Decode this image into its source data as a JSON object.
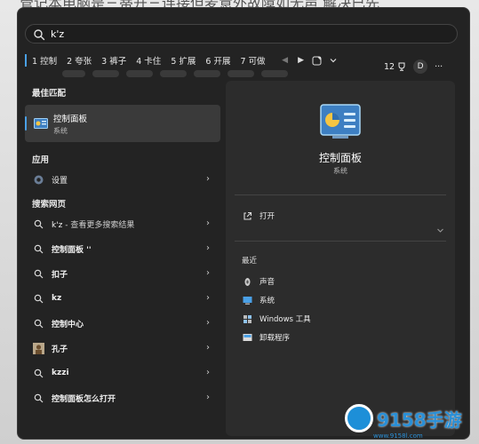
{
  "background": {
    "article_text": "管记本电脑是三蒂开三连接但麦意外故障如无声 解决已先"
  },
  "search": {
    "value": "k'z"
  },
  "ime": {
    "candidates": [
      "1 控制",
      "2 夸张",
      "3 裤子",
      "4 卡住",
      "5 扩展",
      "6 开展",
      "7 可做"
    ]
  },
  "header": {
    "points": "12",
    "avatar_letter": "D",
    "more": "···"
  },
  "left": {
    "best_match_title": "最佳匹配",
    "best_match": {
      "name": "控制面板",
      "type": "系统"
    },
    "apps_title": "应用",
    "apps": [
      {
        "label": "设置",
        "icon": "gear-icon"
      }
    ],
    "web_title": "搜索网页",
    "web": [
      {
        "label": "k'z",
        "sub": " - 查看更多搜索结果",
        "icon": "search-icon"
      },
      {
        "label": "控制面板 ''",
        "sub": "",
        "icon": "search-icon"
      },
      {
        "label": "扣子",
        "sub": "",
        "icon": "search-icon"
      },
      {
        "label": "kz",
        "sub": "",
        "icon": "search-icon"
      },
      {
        "label": "控制中心",
        "sub": "",
        "icon": "search-icon"
      },
      {
        "label": "孔子",
        "sub": "",
        "icon": "thumbnail-icon"
      },
      {
        "label": "kzzi",
        "sub": "",
        "icon": "search-icon"
      },
      {
        "label": "控制面板怎么打开",
        "sub": "",
        "icon": "search-icon"
      }
    ]
  },
  "right": {
    "title": "控制面板",
    "subtitle": "系统",
    "open_label": "打开",
    "recent_title": "最近",
    "recent": [
      {
        "label": "声音",
        "icon": "speaker-icon"
      },
      {
        "label": "系统",
        "icon": "monitor-icon"
      },
      {
        "label": "Windows 工具",
        "icon": "tools-icon"
      },
      {
        "label": "卸载程序",
        "icon": "uninstall-icon"
      }
    ]
  },
  "watermark": {
    "brand": "9158手游",
    "url": "www.9158l.com"
  },
  "colors": {
    "panel": "#232323",
    "detail": "#2c2c2c",
    "accent": "#4aa0e6",
    "selected": "#3a3a3a"
  }
}
